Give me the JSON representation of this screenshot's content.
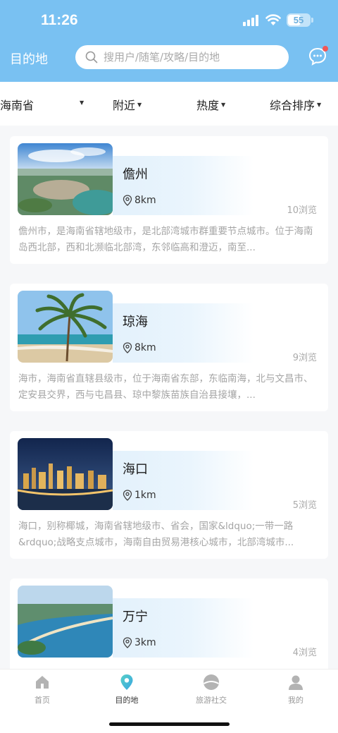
{
  "status_bar": {
    "time": "11:26",
    "battery": "55"
  },
  "header": {
    "title": "目的地",
    "search_placeholder": "搜用户/随笔/攻略/目的地"
  },
  "filters": [
    {
      "label": "海南省"
    },
    {
      "label": "附近"
    },
    {
      "label": "热度"
    },
    {
      "label": "综合排序"
    }
  ],
  "destinations": [
    {
      "name": "儋州",
      "distance": "8km",
      "views": "10浏览",
      "description": "儋州市，是海南省辖地级市，是北部湾城市群重要节点城市。位于海南岛西北部，西和北濒临北部湾，东邻临高和澄迈，南至..."
    },
    {
      "name": "琼海",
      "distance": "8km",
      "views": "9浏览",
      "description": "海市，海南省直辖县级市，位于海南省东部，东临南海，北与文昌市、定安县交界，西与屯昌县、琼中黎族苗族自治县接壤，..."
    },
    {
      "name": "海口",
      "distance": "1km",
      "views": "5浏览",
      "description": "海口，别称椰城，海南省辖地级市、省会，国家&ldquo;一带一路&rdquo;战略支点城市，海南自由贸易港核心城市，北部湾城市..."
    },
    {
      "name": "万宁",
      "distance": "3km",
      "views": "4浏览",
      "description": ""
    }
  ],
  "tabbar": [
    {
      "label": "首页"
    },
    {
      "label": "目的地"
    },
    {
      "label": "旅游社交"
    },
    {
      "label": "我的"
    }
  ],
  "colors": {
    "header": "#79c1f2",
    "accent": "#5cc4d8",
    "badge": "#f25757"
  }
}
